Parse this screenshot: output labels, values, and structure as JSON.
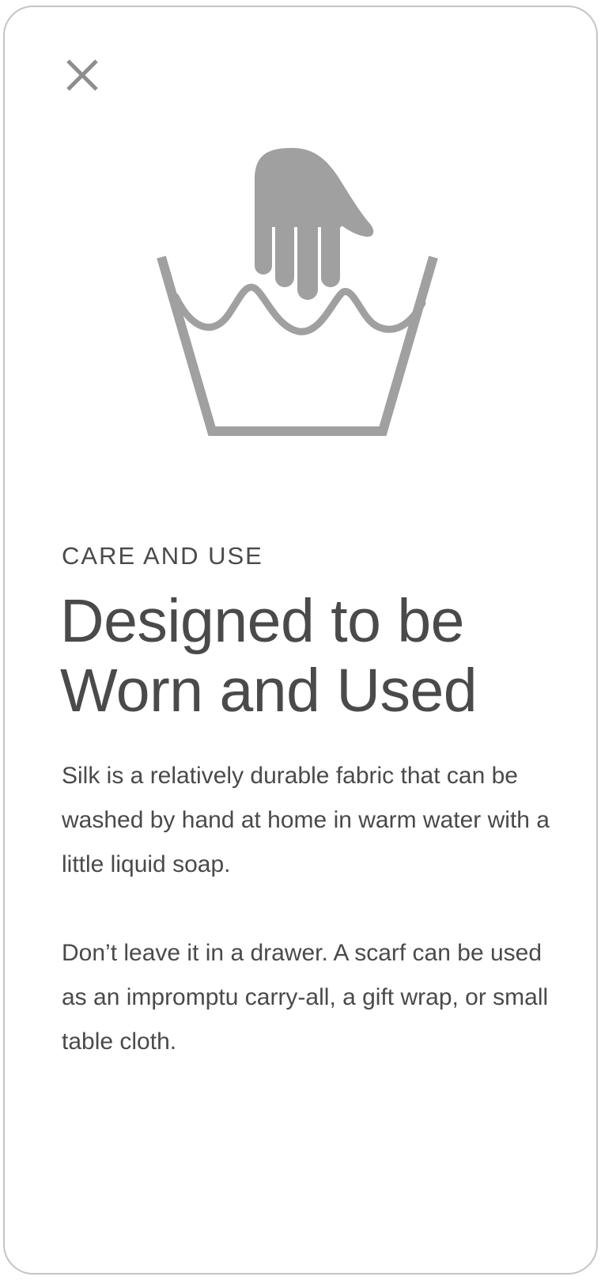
{
  "dialog": {
    "close_icon": "close-icon",
    "illustration_icon": "hand-wash-icon",
    "icon_color": "#a0a0a0",
    "text_color": "#4a4a4a",
    "eyebrow": "CARE AND USE",
    "title_line1": "Designed to be",
    "title_line2": "Worn and Used",
    "paragraphs": [
      "Silk is a relatively durable fabric that can be washed by hand at home in warm water with a little liquid soap.",
      "Don’t leave it in a drawer. A scarf can be used as an impromptu carry-all, a gift wrap, or small table cloth."
    ]
  }
}
